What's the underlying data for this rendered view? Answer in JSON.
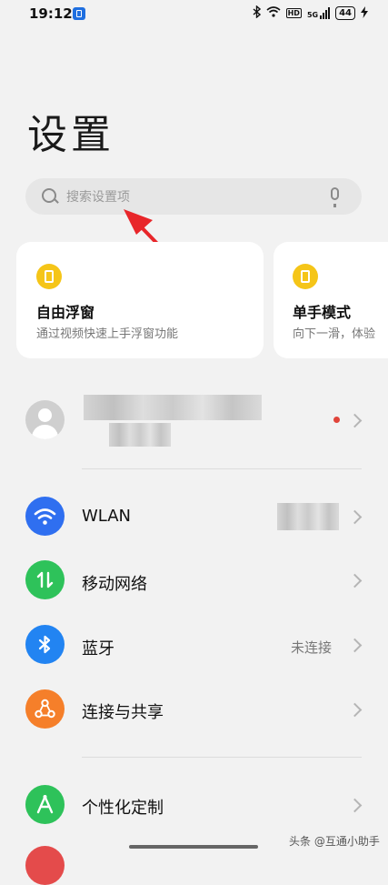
{
  "status_bar": {
    "time": "19:12",
    "hd_label": "HD",
    "network": "5G",
    "battery": "44"
  },
  "page_title": "设置",
  "search": {
    "placeholder": "搜索设置项"
  },
  "cards": [
    {
      "title": "自由浮窗",
      "subtitle": "通过视频快速上手浮窗功能"
    },
    {
      "title": "单手模式",
      "subtitle": "向下一滑，体验"
    }
  ],
  "settings": [
    {
      "label": "WLAN",
      "value": "",
      "color": "#2f6ff0",
      "icon": "wifi-icon"
    },
    {
      "label": "移动网络",
      "value": "",
      "color": "#2ec25a",
      "icon": "mobile-network-icon"
    },
    {
      "label": "蓝牙",
      "value": "未连接",
      "color": "#2284f2",
      "icon": "bluetooth-icon"
    },
    {
      "label": "连接与共享",
      "value": "",
      "color": "#f57f2a",
      "icon": "share-icon"
    },
    {
      "label": "个性化定制",
      "value": "",
      "color": "#2ec25a",
      "icon": "personalize-icon"
    }
  ],
  "watermark": "头条 @互通小助手",
  "colors": {
    "accent_arrow": "#e8262a",
    "card_icon": "#f5c518"
  }
}
